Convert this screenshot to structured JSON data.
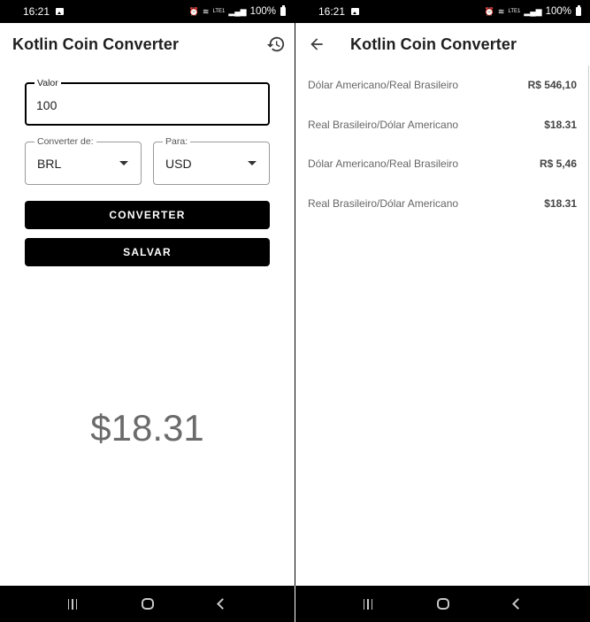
{
  "status_bar": {
    "time": "16:21",
    "network_text": "LTE1",
    "battery": "100%"
  },
  "converter": {
    "title": "Kotlin Coin Converter",
    "amount": {
      "label": "Valor",
      "value": "100"
    },
    "from": {
      "label": "Converter de:",
      "value": "BRL"
    },
    "to": {
      "label": "Para:",
      "value": "USD"
    },
    "convert_button": "CONVERTER",
    "save_button": "SALVAR",
    "result": "$18.31"
  },
  "history": {
    "title": "Kotlin Coin Converter",
    "items": [
      {
        "pair": "Dólar Americano/Real Brasileiro",
        "value": "R$ 546,10"
      },
      {
        "pair": "Real Brasileiro/Dólar Americano",
        "value": "$18.31"
      },
      {
        "pair": "Dólar Americano/Real Brasileiro",
        "value": "R$ 5,46"
      },
      {
        "pair": "Real Brasileiro/Dólar Americano",
        "value": "$18.31"
      }
    ]
  },
  "icons": {
    "history": "history-icon",
    "back": "arrow-back-icon",
    "dropdown": "arrow-drop-down-icon"
  },
  "colors": {
    "button_bg": "#000000",
    "result_text": "#6b6b6b"
  }
}
